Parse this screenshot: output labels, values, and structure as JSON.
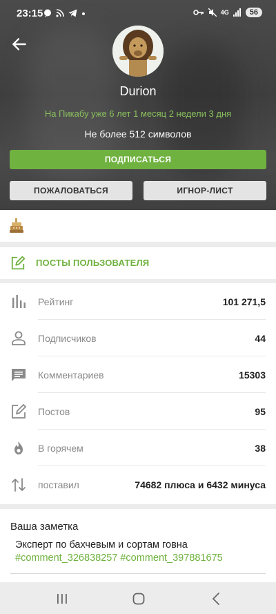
{
  "status_bar": {
    "time": "23:15",
    "network": "4G",
    "battery": "56",
    "left_icons": [
      "chat-icon",
      "rss-icon",
      "telegram-icon",
      "dot-icon"
    ],
    "right_icons": [
      "key-icon",
      "mute-icon",
      "network-4g-icon",
      "signal-icon",
      "battery-icon"
    ]
  },
  "profile": {
    "username": "Durion",
    "since": "На Пикабу уже 6 лет 1 месяц 2 недели 3 дня",
    "about": "Не более 512 символов",
    "subscribe_label": "ПОДПИСАТЬСЯ",
    "report_label": "ПОЖАЛОВАТЬСЯ",
    "ignore_label": "ИГНОР-ЛИСТ"
  },
  "posts_link": {
    "label": "ПОСТЫ ПОЛЬЗОВАТЕЛЯ"
  },
  "stats": [
    {
      "icon": "bar-chart-icon",
      "label": "Рейтинг",
      "value": "101 271,5"
    },
    {
      "icon": "person-icon",
      "label": "Подписчиков",
      "value": "44"
    },
    {
      "icon": "comment-icon",
      "label": "Комментариев",
      "value": "15303"
    },
    {
      "icon": "edit-icon",
      "label": "Постов",
      "value": "95"
    },
    {
      "icon": "fire-icon",
      "label": "В горячем",
      "value": "38"
    },
    {
      "icon": "arrows-up-down-icon",
      "label": "поставил",
      "value": "74682 плюса и 6432 минуса"
    }
  ],
  "note": {
    "title": "Ваша заметка",
    "text": "Эксперт по бахчевым и сортам говна",
    "links": "#comment_326838257 #comment_397881675"
  },
  "colors": {
    "accent": "#6fb23f",
    "since_text": "#8ac05d"
  }
}
